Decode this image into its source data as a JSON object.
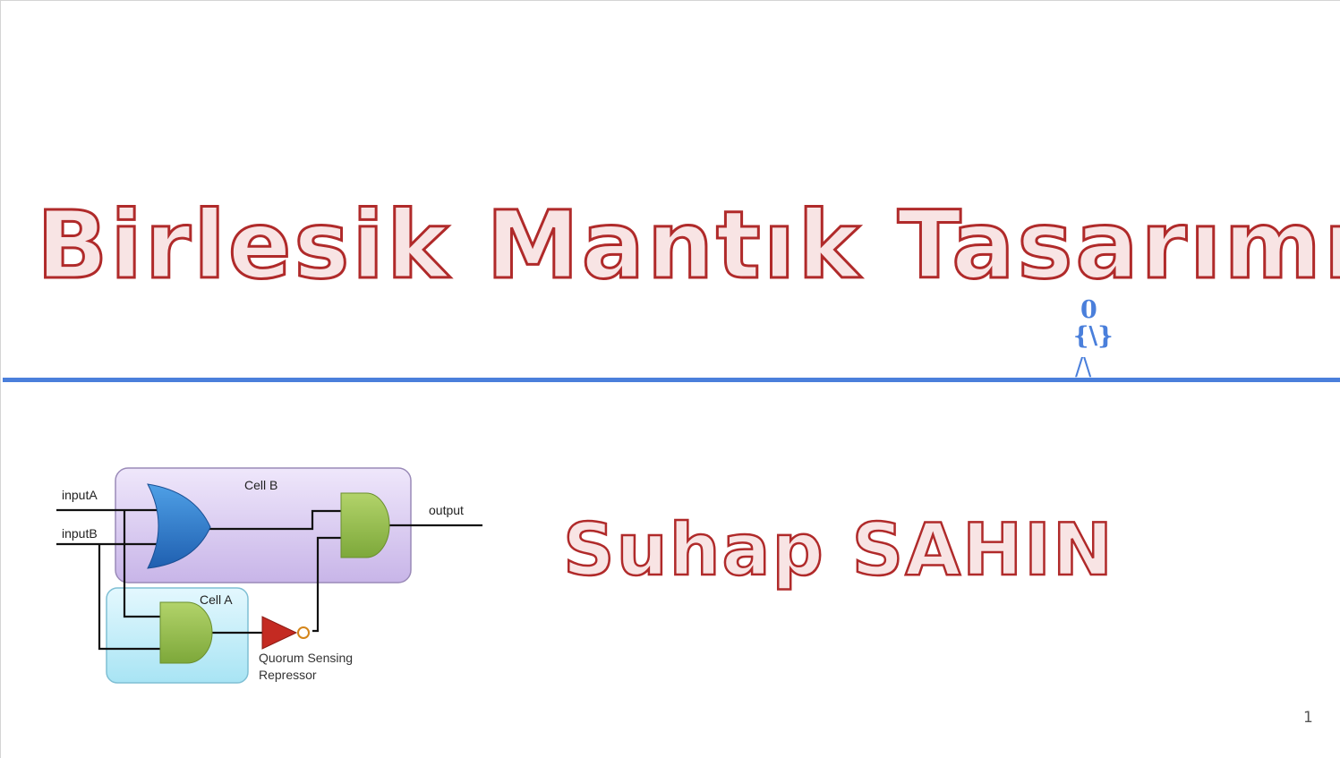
{
  "slide": {
    "title": "Birlesik Mantık Tasarımı",
    "author": "Suhap SAHIN",
    "page_number": "1",
    "accent_color": "#4a7fdb",
    "title_color": "#b02a2a"
  },
  "figure_icon": {
    "head": "0",
    "body": "{\\}",
    "legs": "/\\"
  },
  "diagram": {
    "cell_b_label": "Cell B",
    "cell_a_label": "Cell A",
    "input_a": "inputA",
    "input_b": "inputB",
    "output": "output",
    "repressor_line1": "Quorum Sensing",
    "repressor_line2": "Repressor"
  }
}
